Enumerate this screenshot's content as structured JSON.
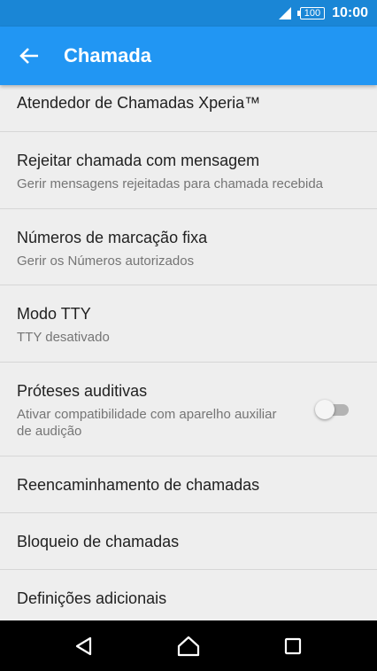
{
  "status_bar": {
    "battery_level": "100",
    "time": "10:00",
    "icons": [
      "signal-icon",
      "battery-icon"
    ]
  },
  "app_bar": {
    "title": "Chamada",
    "back_icon": "arrow-left-icon",
    "background": "#2196f3",
    "status_background": "#1a86d6"
  },
  "settings": {
    "items": [
      {
        "title": "Atendedor de Chamadas Xperia™"
      },
      {
        "title": "Rejeitar chamada com mensagem",
        "subtitle": "Gerir mensagens rejeitadas para chamada recebida"
      },
      {
        "title": "Números de marcação fixa",
        "subtitle": "Gerir os Números autorizados"
      },
      {
        "title": "Modo TTY",
        "subtitle": "TTY desativado"
      },
      {
        "title": "Próteses auditivas",
        "subtitle": "Ativar compatibilidade com aparelho auxiliar de audição",
        "toggle_on": false
      },
      {
        "title": "Reencaminhamento de chamadas"
      },
      {
        "title": "Bloqueio de chamadas"
      },
      {
        "title": "Definições adicionais"
      }
    ]
  },
  "nav_bar": {
    "buttons": [
      "back-triangle-icon",
      "home-icon",
      "recents-square-icon"
    ]
  }
}
